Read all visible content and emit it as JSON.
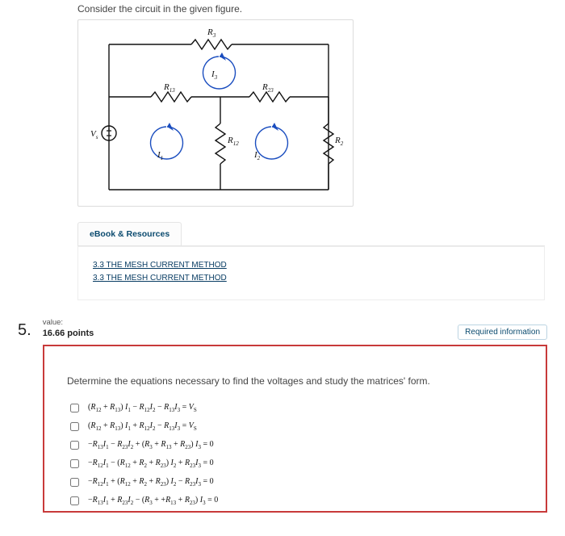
{
  "q4": {
    "prompt": "Consider the circuit in the given figure.",
    "tab": "eBook & Resources",
    "refs": [
      "3.3 THE MESH CURRENT METHOD",
      "3.3 THE MESH CURRENT METHOD"
    ],
    "circuit": {
      "Vs": "V_s",
      "R3": "R_3",
      "R13": "R_{13}",
      "R23": "R_{23}",
      "R12": "R_{12}",
      "R2": "R_2",
      "I1": "I_1",
      "I2": "I_2",
      "I3": "I_3"
    }
  },
  "q5": {
    "number": "5.",
    "value_label": "value:",
    "points": "16.66 points",
    "required": "Required information",
    "prompt": "Determine the equations necessary to find the voltages and study the matrices' form.",
    "options": [
      "(R₁₂ + R₁₃) I₁ − R₁₂I₂ − R₁₃I₃ = V_S",
      "(R₁₂ + R₁₃) I₁ + R₁₂I₂ − R₁₃I₃ = V_S",
      "−R₁₃I₁ − R₂₃I₂ + (R₃ + R₁₃ + R₂₃) I₃ = 0",
      "−R₁₂I₁ − (R₁₂ + R₂ + R₂₃) I₂ + R₂₃I₃ = 0",
      "−R₁₂I₁ + (R₁₂ + R₂ + R₂₃) I₂ − R₂₃I₃ = 0",
      "−R₁₃I₁ + R₂₃I₂ − (R₃ + +R₁₃ + R₂₃) I₃ = 0"
    ]
  }
}
